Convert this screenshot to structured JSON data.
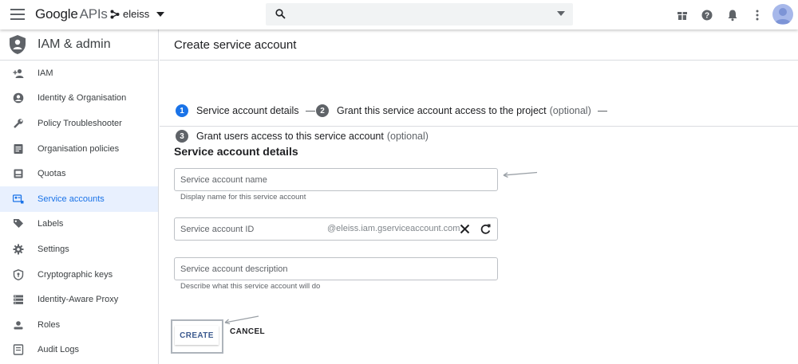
{
  "topbar": {
    "logo_google": "Google",
    "logo_apis": "APIs",
    "project_name": "eleiss",
    "search_placeholder": "",
    "icons": [
      "menu-icon",
      "project-icon",
      "search-icon",
      "gift-icon",
      "help-icon",
      "notifications-icon",
      "more-vert-icon"
    ]
  },
  "sidebar": {
    "title": "IAM & admin",
    "items": [
      {
        "label": "IAM",
        "icon": "person-add-icon"
      },
      {
        "label": "Identity & Organisation",
        "icon": "account-circle-icon"
      },
      {
        "label": "Policy Troubleshooter",
        "icon": "wrench-icon"
      },
      {
        "label": "Organisation policies",
        "icon": "policy-doc-icon"
      },
      {
        "label": "Quotas",
        "icon": "quota-icon"
      },
      {
        "label": "Service accounts",
        "icon": "service-account-icon",
        "active": true
      },
      {
        "label": "Labels",
        "icon": "label-icon"
      },
      {
        "label": "Settings",
        "icon": "settings-icon"
      },
      {
        "label": "Cryptographic keys",
        "icon": "key-shield-icon"
      },
      {
        "label": "Identity-Aware Proxy",
        "icon": "proxy-icon"
      },
      {
        "label": "Roles",
        "icon": "roles-icon"
      },
      {
        "label": "Audit Logs",
        "icon": "audit-icon"
      }
    ]
  },
  "main": {
    "title": "Create service account",
    "steps": [
      {
        "num": "1",
        "label": "Service account details",
        "optional": ""
      },
      {
        "num": "2",
        "label": "Grant this service account access to the project",
        "optional": "(optional)"
      },
      {
        "num": "3",
        "label": "Grant users access to this service account",
        "optional": "(optional)"
      }
    ],
    "section_title": "Service account details",
    "fields": {
      "name_placeholder": "Service account name",
      "name_hint": "Display name for this service account",
      "id_placeholder": "Service account ID",
      "id_suffix": "@eleiss.iam.gserviceaccount.com",
      "description_placeholder": "Service account description",
      "description_hint": "Describe what this service account will do"
    },
    "create_label": "CREATE",
    "cancel_label": "CANCEL"
  },
  "colors": {
    "accent": "#1a73e8",
    "active_bg": "#e8f0fe",
    "step_grey": "#5f6368"
  }
}
